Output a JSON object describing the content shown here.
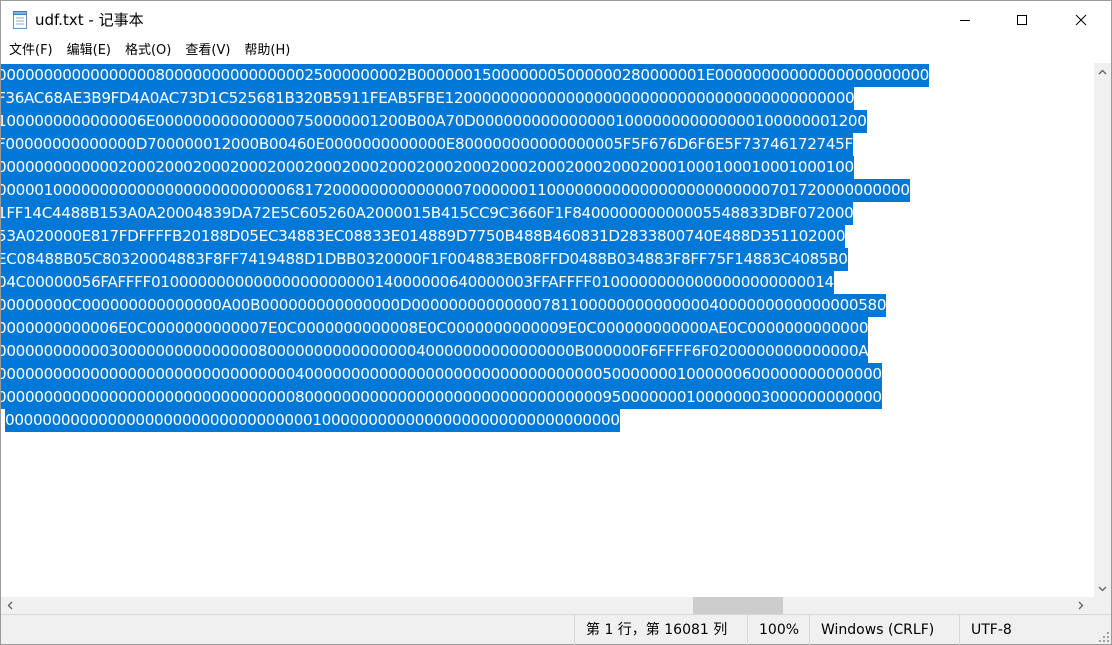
{
  "window": {
    "title": "udf.txt - 记事本",
    "icon": "notepad-icon"
  },
  "menu": [
    "文件(F)",
    "编辑(E)",
    "格式(O)",
    "查看(V)",
    "帮助(H)"
  ],
  "editor": {
    "selection_color": "#0078d7",
    "lines": [
      "00000000000000000800000000000000025000000002B0000001500000005000000280000001E00000000000000000000000",
      "F36AC68AE3B9FD4A0AC73D1C525681B320B5911FEAB5FBE12000000000000000000000000000000000000000000",
      "1000000000000006E000000000000000750000001200B00A70D000000000000000100000000000000100000001200",
      "F00000000000000D700000012000B00460E0000000000000E800000000000000005F5F676D6F6E5F73746172745F",
      "00000000000002000200020002000200020002000200020002000200020002000200020001000100010001000100",
      "00000100000000000000000000000006817200000000000000700000011000000000000000000000000701720000000000",
      "1FF14C4488B153A0A20004839DA72E5C605260A2000015B415CC9C3660F1F840000000000005548833DBF072000",
      "53A020000E817FDFFFFB20188D05EC34883EC08833E014889D7750B488B460831D2833800740E488D351102000",
      "EC08488B05C80320004883F8FF7419488D1DBB0320000F1F004883EB08FFD0488B034883F8FF75F14883C4085B0",
      "04C00000056FAFFFF01000000000000000000000014000000640000003FFAFFFF01000000000000000000000014",
      "00000000C000000000000000A00B000000000000000D000000000000007811000000000000004000000000000000580",
      "0000000000006E0C0000000000007E0C0000000000008E0C0000000000009E0C000000000000AE0C0000000000000",
      "00000000000030000000000000008000000000000000040000000000000000B000000F6FFFF6F0200000000000000A",
      "00000000000000000000000000000000400000000000000000000000000000000500000001000000600000000000000",
      "00000000000000000000000000000000800000000000000000000000000000000950000000100000003000000000000",
      "000000000000000000000000000000000100000000000000000000000000000000"
    ]
  },
  "scrollbar": {
    "up": "scroll-up-arrow-icon",
    "down": "scroll-down-arrow-icon",
    "left": "scroll-left-arrow-icon",
    "right": "scroll-right-arrow-icon"
  },
  "status": {
    "position": "第 1 行，第 16081 列",
    "zoom": "100%",
    "line_ending": "Windows (CRLF)",
    "encoding": "UTF-8"
  }
}
